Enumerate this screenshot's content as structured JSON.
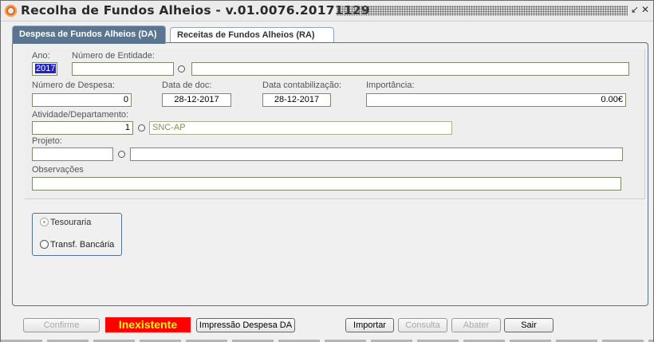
{
  "window": {
    "title": "Recolha de Fundos Alheios - v.01.0076.20171129",
    "title_buttons": [
      "↙",
      "✕"
    ]
  },
  "tabs": [
    {
      "label": "Despesa de Fundos Alheios (DA)",
      "active": true
    },
    {
      "label": "Receitas de Fundos Alheios (RA)",
      "active": false
    }
  ],
  "form": {
    "ano": {
      "label": "Ano:",
      "value": "2017"
    },
    "numero_entidade": {
      "label": "Número de Entidade:",
      "value": "",
      "description": ""
    },
    "numero_despesa": {
      "label": "Número de Despesa:",
      "value": "0"
    },
    "data_doc": {
      "label": "Data de doc:",
      "value": "28-12-2017"
    },
    "data_contabilizacao": {
      "label": "Data contabilização:",
      "value": "28-12-2017"
    },
    "importancia": {
      "label": "Importância:",
      "value": "0.00€"
    },
    "atividade": {
      "label": "Atividade/Departamento:",
      "value": "1",
      "description": "SNC-AP"
    },
    "projeto": {
      "label": "Projeto:",
      "value": "",
      "description": ""
    },
    "observacoes": {
      "label": "Observações",
      "value": ""
    }
  },
  "payment": {
    "options": [
      {
        "label": "Tesouraria",
        "checked": true
      },
      {
        "label": "Transf. Bancária",
        "checked": false
      }
    ]
  },
  "footer": {
    "confirmar": "Confirme",
    "status": "Inexistente",
    "impressao": "Impressão Despesa DA",
    "importar": "Importar",
    "consulta": "Consulta",
    "abater": "Abater",
    "sair": "Sair"
  },
  "colors": {
    "accent": "#5b7590",
    "status_bg": "#ff0000",
    "status_fg": "#ffff00"
  }
}
